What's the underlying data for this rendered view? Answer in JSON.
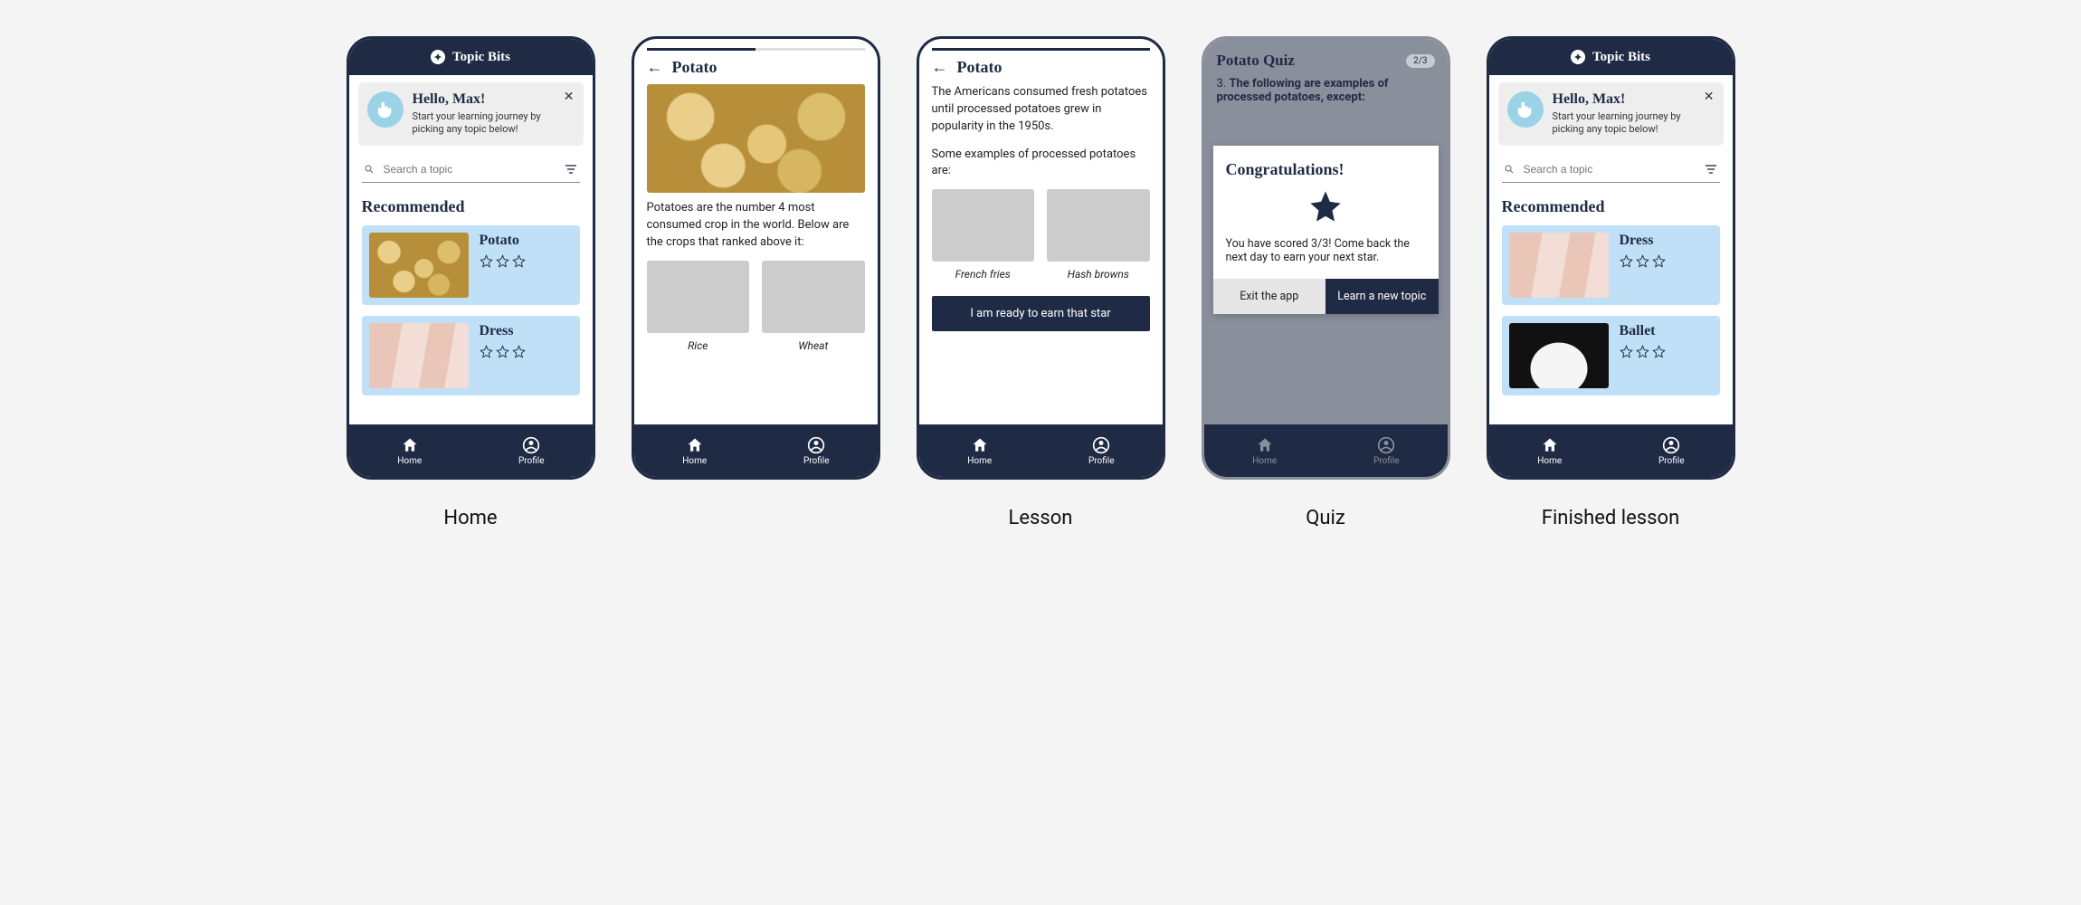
{
  "app_title": "Topic Bits",
  "nav": {
    "home": "Home",
    "profile": "Profile"
  },
  "greeting": {
    "title": "Hello, Max!",
    "subtitle": "Start your learning journey by picking any topic below!"
  },
  "search": {
    "placeholder": "Search a topic"
  },
  "home": {
    "section": "Recommended",
    "cards": [
      {
        "title": "Potato"
      },
      {
        "title": "Dress"
      }
    ]
  },
  "lesson1": {
    "title": "Potato",
    "progress_pct": 50,
    "para": "Potatoes are the number 4 most consumed crop in the world. Below are the crops that ranked above it:",
    "items": [
      {
        "label": "Rice"
      },
      {
        "label": "Wheat"
      }
    ]
  },
  "lesson2": {
    "title": "Potato",
    "progress_pct": 100,
    "para1": "The Americans consumed fresh potatoes until processed potatoes grew in popularity in the 1950s.",
    "para2": "Some examples of processed potatoes are:",
    "items": [
      {
        "label": "French fries"
      },
      {
        "label": "Hash browns"
      }
    ],
    "cta": "I am ready to earn that star"
  },
  "quiz": {
    "title": "Potato Quiz",
    "counter": "2/3",
    "qnum": "3.",
    "question": "The following are examples of processed potatoes, except:",
    "modal": {
      "title": "Congratulations!",
      "body": "You have scored 3/3! Come back the next day to earn your next star.",
      "exit": "Exit the app",
      "learn": "Learn a new topic"
    }
  },
  "finished": {
    "section": "Recommended",
    "cards": [
      {
        "title": "Dress"
      },
      {
        "title": "Ballet"
      }
    ]
  },
  "captions": {
    "home": "Home",
    "lesson": "Lesson",
    "quiz": "Quiz",
    "finished": "Finished lesson"
  }
}
